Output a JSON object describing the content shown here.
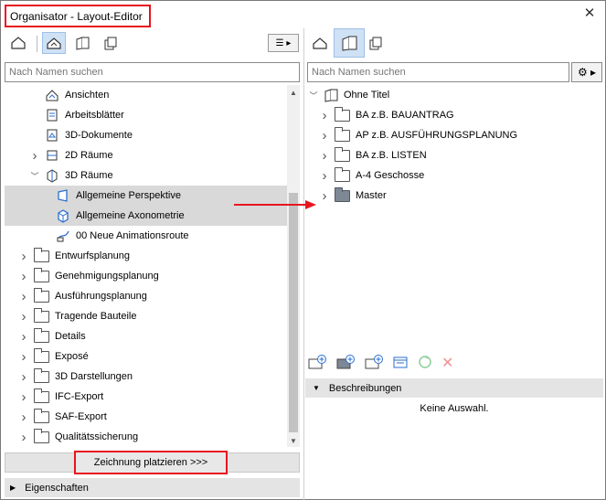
{
  "window": {
    "title": "Organisator - Layout-Editor"
  },
  "left": {
    "search_placeholder": "Nach Namen suchen",
    "tree": [
      {
        "label": "Ansichten",
        "icon": "view-icon",
        "indent": 2,
        "chevron": "",
        "selected": false
      },
      {
        "label": "Arbeitsblätter",
        "icon": "worksheet-icon",
        "indent": 2,
        "chevron": "",
        "selected": false
      },
      {
        "label": "3D-Dokumente",
        "icon": "3d-document-icon",
        "indent": 2,
        "chevron": "",
        "selected": false
      },
      {
        "label": "2D Räume",
        "icon": "2d-space-icon",
        "indent": 2,
        "chevron": "right",
        "selected": false
      },
      {
        "label": "3D Räume",
        "icon": "3d-space-icon",
        "indent": 2,
        "chevron": "down",
        "selected": false
      },
      {
        "label": "Allgemeine Perspektive",
        "icon": "perspective-icon",
        "indent": 3,
        "chevron": "",
        "selected": true
      },
      {
        "label": "Allgemeine Axonometrie",
        "icon": "axonometry-icon",
        "indent": 3,
        "chevron": "",
        "selected": true
      },
      {
        "label": "00 Neue Animationsroute",
        "icon": "animation-icon",
        "indent": 3,
        "chevron": "",
        "selected": false
      },
      {
        "label": "Entwurfsplanung",
        "icon": "folder-icon",
        "indent": 1,
        "chevron": "right",
        "selected": false
      },
      {
        "label": "Genehmigungsplanung",
        "icon": "folder-icon",
        "indent": 1,
        "chevron": "right",
        "selected": false
      },
      {
        "label": "Ausführungsplanung",
        "icon": "folder-icon",
        "indent": 1,
        "chevron": "right",
        "selected": false
      },
      {
        "label": "Tragende Bauteile",
        "icon": "folder-icon",
        "indent": 1,
        "chevron": "right",
        "selected": false
      },
      {
        "label": "Details",
        "icon": "folder-icon",
        "indent": 1,
        "chevron": "right",
        "selected": false
      },
      {
        "label": "Exposé",
        "icon": "folder-icon",
        "indent": 1,
        "chevron": "right",
        "selected": false
      },
      {
        "label": "3D Darstellungen",
        "icon": "folder-icon",
        "indent": 1,
        "chevron": "right",
        "selected": false
      },
      {
        "label": "IFC-Export",
        "icon": "folder-icon",
        "indent": 1,
        "chevron": "right",
        "selected": false
      },
      {
        "label": "SAF-Export",
        "icon": "folder-icon",
        "indent": 1,
        "chevron": "right",
        "selected": false
      },
      {
        "label": "Qualitätssicherung",
        "icon": "folder-icon",
        "indent": 1,
        "chevron": "right",
        "selected": false
      }
    ],
    "place_button": "Zeichnung platzieren >>>",
    "properties_header": "Eigenschaften"
  },
  "right": {
    "search_placeholder": "Nach Namen suchen",
    "tree": [
      {
        "label": "Ohne Titel",
        "icon": "layout-book-icon",
        "indent": 0,
        "chevron": "down"
      },
      {
        "label": "BA z.B. BAUANTRAG",
        "icon": "folder-icon",
        "indent": 1,
        "chevron": "right"
      },
      {
        "label": "AP z.B. AUSFÜHRUNGSPLANUNG",
        "icon": "folder-icon",
        "indent": 1,
        "chevron": "right"
      },
      {
        "label": "BA z.B. LISTEN",
        "icon": "folder-icon",
        "indent": 1,
        "chevron": "right"
      },
      {
        "label": "A-4 Geschosse",
        "icon": "folder-icon",
        "indent": 1,
        "chevron": "right"
      },
      {
        "label": "Master",
        "icon": "master-folder-icon",
        "indent": 1,
        "chevron": "right"
      }
    ],
    "descriptions_header": "Beschreibungen",
    "no_selection": "Keine Auswahl."
  },
  "colors": {
    "highlight_red": "#e8141e",
    "active_blue": "#cfe1f5",
    "selection_gray": "#d9d9d9"
  }
}
